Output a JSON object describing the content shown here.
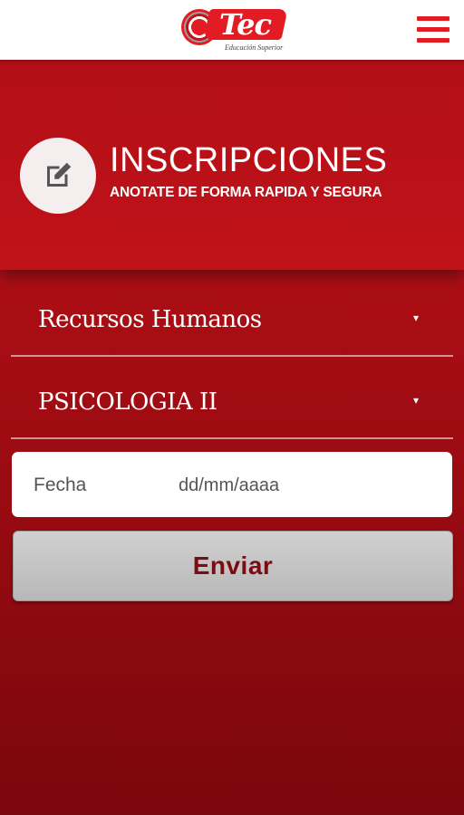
{
  "header": {
    "logo_text": "Tec",
    "logo_tagline": "Educación Superior",
    "menu_icon": "hamburger-menu-icon"
  },
  "hero": {
    "icon": "edit-icon",
    "title": "INSCRIPCIONES",
    "subtitle": "ANOTATE DE FORMA RAPIDA Y SEGURA"
  },
  "form": {
    "career_select": {
      "value": "Recursos Humanos",
      "caret": "▾"
    },
    "subject_select": {
      "value": "PSICOLOGIA II",
      "caret": "▾"
    },
    "date": {
      "label": "Fecha",
      "placeholder": "dd/mm/aaaa"
    },
    "submit_label": "Enviar"
  },
  "colors": {
    "brand_red": "#e31b23",
    "hero_red": "#b30f16",
    "button_text": "#7a0c12"
  }
}
